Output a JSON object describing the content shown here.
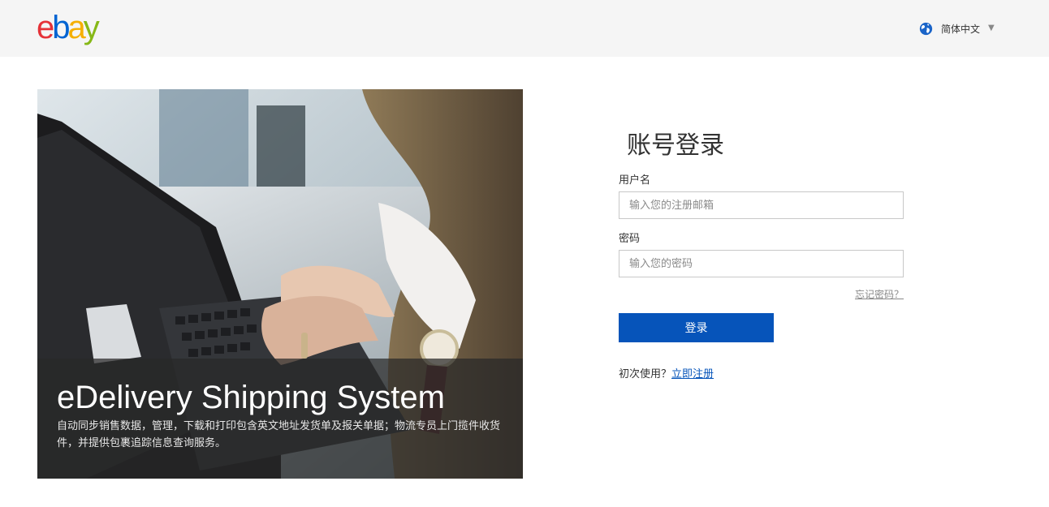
{
  "header": {
    "logo": {
      "letters": [
        "e",
        "b",
        "a",
        "y"
      ],
      "colors": [
        "#e53238",
        "#0064d2",
        "#f5af02",
        "#86b817"
      ]
    },
    "language": {
      "label": "简体中文",
      "icon": "globe-icon",
      "caret_icon": "caret-down-icon"
    }
  },
  "hero": {
    "title": "eDelivery Shipping System",
    "description": "自动同步销售数据，管理，下载和打印包含英文地址发货单及报关单据；物流专员上门揽件收货件，并提供包裹追踪信息查询服务。"
  },
  "login": {
    "title": "账号登录",
    "username": {
      "label": "用户名",
      "placeholder": "输入您的注册邮箱",
      "value": ""
    },
    "password": {
      "label": "密码",
      "placeholder": "输入您的密码",
      "value": ""
    },
    "forgot_label": "忘记密码？",
    "submit_label": "登录",
    "signup_prompt": "初次使用？",
    "signup_link": "立即注册"
  },
  "colors": {
    "accent": "#0654ba",
    "topbar_bg": "#f5f5f5"
  }
}
